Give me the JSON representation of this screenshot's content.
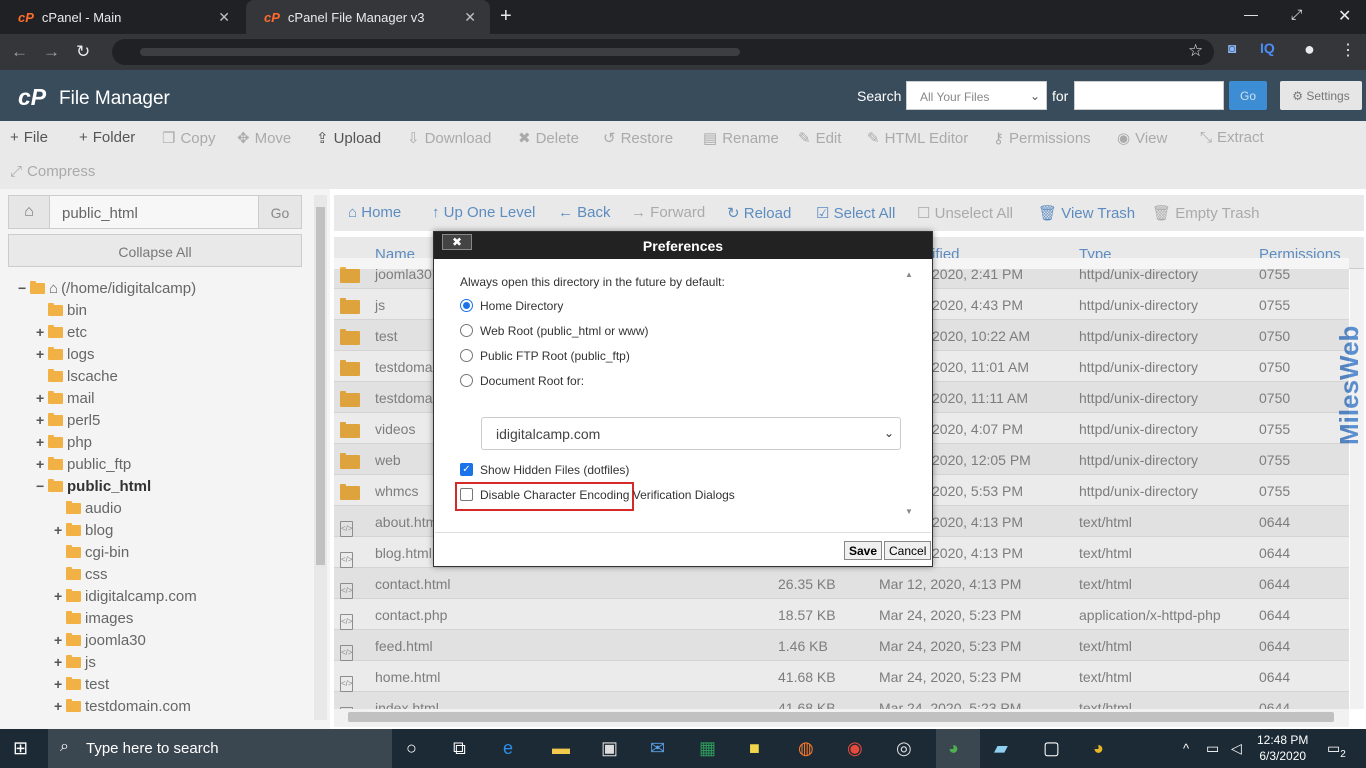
{
  "browser": {
    "tabs": [
      {
        "title": "cPanel - Main",
        "active": false
      },
      {
        "title": "cPanel File Manager v3",
        "active": true
      }
    ],
    "new_tab": "+",
    "favicon": "cP"
  },
  "header": {
    "logo": "cP",
    "title": "File Manager",
    "search_label": "Search",
    "search_scope": "All Your Files",
    "for_label": "for",
    "go": "Go",
    "settings": "Settings"
  },
  "toolbar": {
    "file": "File",
    "folder": "Folder",
    "copy": "Copy",
    "move": "Move",
    "upload": "Upload",
    "download": "Download",
    "delete": "Delete",
    "restore": "Restore",
    "rename": "Rename",
    "edit": "Edit",
    "html_editor": "HTML Editor",
    "permissions": "Permissions",
    "view": "View",
    "extract": "Extract",
    "compress": "Compress"
  },
  "sidebar": {
    "path": "public_html",
    "go": "Go",
    "collapse_all": "Collapse All",
    "tree": [
      {
        "label": "(/home/idigitalcamp)",
        "pm": "−",
        "home": true
      },
      {
        "label": "bin",
        "pm": ""
      },
      {
        "label": "etc",
        "pm": "+"
      },
      {
        "label": "logs",
        "pm": "+"
      },
      {
        "label": "lscache",
        "pm": ""
      },
      {
        "label": "mail",
        "pm": "+"
      },
      {
        "label": "perl5",
        "pm": "+"
      },
      {
        "label": "php",
        "pm": "+"
      },
      {
        "label": "public_ftp",
        "pm": "+"
      },
      {
        "label": "public_html",
        "pm": "−",
        "selected": true
      },
      {
        "label": "audio",
        "pm": ""
      },
      {
        "label": "blog",
        "pm": "+"
      },
      {
        "label": "cgi-bin",
        "pm": ""
      },
      {
        "label": "css",
        "pm": ""
      },
      {
        "label": "idigitalcamp.com",
        "pm": "+"
      },
      {
        "label": "images",
        "pm": ""
      },
      {
        "label": "joomla30",
        "pm": "+"
      },
      {
        "label": "js",
        "pm": "+"
      },
      {
        "label": "test",
        "pm": "+"
      },
      {
        "label": "testdomain.com",
        "pm": "+"
      }
    ]
  },
  "navbar": {
    "home": "Home",
    "up": "Up One Level",
    "back": "Back",
    "forward": "Forward",
    "reload": "Reload",
    "select_all": "Select All",
    "unselect_all": "Unselect All",
    "view_trash": "View Trash",
    "empty_trash": "Empty Trash"
  },
  "table": {
    "headers": {
      "name": "Name",
      "modified": "ified",
      "type": "Type",
      "permissions": "Permissions"
    },
    "rows": [
      {
        "name": "joomla30",
        "size": "",
        "modified": "2020, 2:41 PM",
        "type": "httpd/unix-directory",
        "perm": "0755",
        "kind": "folder"
      },
      {
        "name": "js",
        "size": "",
        "modified": "2020, 4:43 PM",
        "type": "httpd/unix-directory",
        "perm": "0755",
        "kind": "folder"
      },
      {
        "name": "test",
        "size": "",
        "modified": "2020, 10:22 AM",
        "type": "httpd/unix-directory",
        "perm": "0750",
        "kind": "folder"
      },
      {
        "name": "testdoma",
        "size": "",
        "modified": "2020, 11:01 AM",
        "type": "httpd/unix-directory",
        "perm": "0750",
        "kind": "folder"
      },
      {
        "name": "testdoma",
        "size": "",
        "modified": "2020, 11:11 AM",
        "type": "httpd/unix-directory",
        "perm": "0750",
        "kind": "folder"
      },
      {
        "name": "videos",
        "size": "",
        "modified": "2020, 4:07 PM",
        "type": "httpd/unix-directory",
        "perm": "0755",
        "kind": "folder"
      },
      {
        "name": "web",
        "size": "",
        "modified": "2020, 12:05 PM",
        "type": "httpd/unix-directory",
        "perm": "0755",
        "kind": "folder"
      },
      {
        "name": "whmcs",
        "size": "",
        "modified": "2020, 5:53 PM",
        "type": "httpd/unix-directory",
        "perm": "0755",
        "kind": "folder"
      },
      {
        "name": "about.htm",
        "size": "",
        "modified": "2020, 4:13 PM",
        "type": "text/html",
        "perm": "0644",
        "kind": "file"
      },
      {
        "name": "blog.html",
        "size": "",
        "modified": "2020, 4:13 PM",
        "type": "text/html",
        "perm": "0644",
        "kind": "file"
      },
      {
        "name": "contact.html",
        "size": "26.35 KB",
        "modified": "Mar 12, 2020, 4:13 PM",
        "type": "text/html",
        "perm": "0644",
        "kind": "file"
      },
      {
        "name": "contact.php",
        "size": "18.57 KB",
        "modified": "Mar 24, 2020, 5:23 PM",
        "type": "application/x-httpd-php",
        "perm": "0644",
        "kind": "file"
      },
      {
        "name": "feed.html",
        "size": "1.46 KB",
        "modified": "Mar 24, 2020, 5:23 PM",
        "type": "text/html",
        "perm": "0644",
        "kind": "file"
      },
      {
        "name": "home.html",
        "size": "41.68 KB",
        "modified": "Mar 24, 2020, 5:23 PM",
        "type": "text/html",
        "perm": "0644",
        "kind": "file"
      },
      {
        "name": "index.html",
        "size": "41.68 KB",
        "modified": "Mar 24, 2020, 5:23 PM",
        "type": "text/html",
        "perm": "0644",
        "kind": "file"
      }
    ]
  },
  "watermark": "MilesWeb",
  "dialog": {
    "title": "Preferences",
    "close": "✖",
    "intro": "Always open this directory in the future by default:",
    "opt_home": "Home Directory",
    "opt_webroot": "Web Root (public_html or www)",
    "opt_ftp": "Public FTP Root (public_ftp)",
    "opt_docroot": "Document Root for:",
    "docroot_value": "idigitalcamp.com",
    "show_hidden": "Show Hidden Files (dotfiles)",
    "disable_encoding": "Disable Character Encoding Verification Dialogs",
    "save": "Save",
    "cancel": "Cancel"
  },
  "taskbar": {
    "search_placeholder": "Type here to search",
    "time": "12:48 PM",
    "date": "6/3/2020",
    "notifications": "2"
  }
}
